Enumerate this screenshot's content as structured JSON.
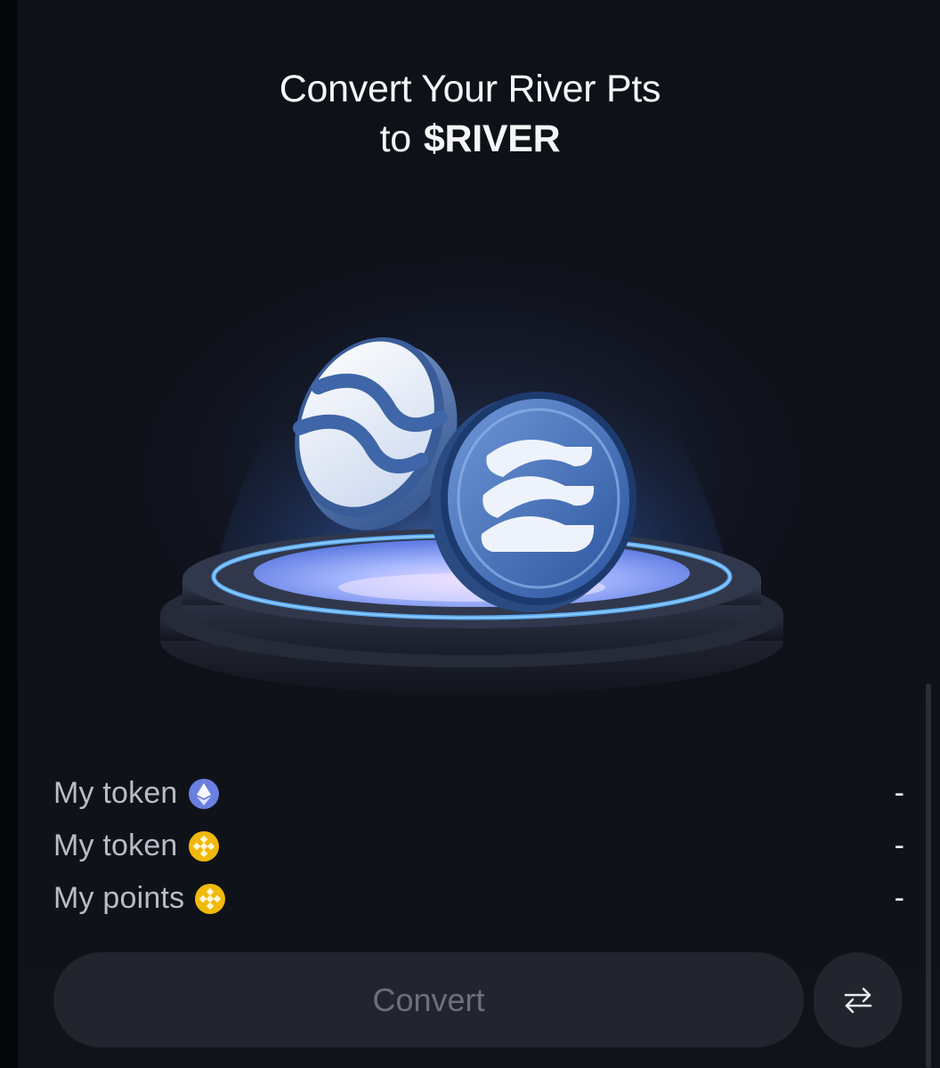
{
  "header": {
    "title_line1": "Convert Your River Pts",
    "title_line2_prefix": "to",
    "title_line2_ticker": "$RIVER"
  },
  "balances": [
    {
      "label": "My token",
      "icon": "ethereum-icon",
      "value": "-"
    },
    {
      "label": "My token",
      "icon": "bnb-icon",
      "value": "-"
    },
    {
      "label": "My points",
      "icon": "bnb-icon",
      "value": "-"
    }
  ],
  "actions": {
    "convert_label": "Convert",
    "swap_icon": "swap-arrows-icon"
  },
  "colors": {
    "background": "#0f1118",
    "accent_blue": "#4a86f0",
    "ethereum": "#6a7fe0",
    "bnb": "#f0b90b",
    "button": "#22252e",
    "button_text": "#6d707b"
  }
}
